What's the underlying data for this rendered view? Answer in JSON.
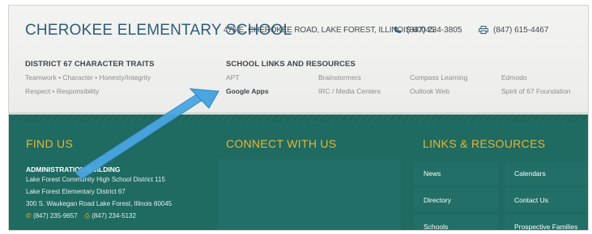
{
  "header": {
    "school_name": "CHEROKEE ELEMENTARY SCHOOL",
    "address": "475 E. CHEROKEE ROAD, LAKE FOREST, ILLINOIS 60045",
    "phone": "(847) 234-3805",
    "fax": "(847) 615-4467",
    "phone_icon": "phone-icon",
    "fax_icon": "printer-icon"
  },
  "traits": {
    "heading": "DISTRICT 67 CHARACTER TRAITS",
    "line1": "Teamwork • Character • Honesty/Integrity",
    "line2": "Respect • Responsibility"
  },
  "resources": {
    "heading": "SCHOOL LINKS AND RESOURCES",
    "links": [
      {
        "label": "APT"
      },
      {
        "label": "Brainstormers"
      },
      {
        "label": "Compass Learning"
      },
      {
        "label": "Edmodo"
      },
      {
        "label": "Google Apps"
      },
      {
        "label": "IRC / Media Centers"
      },
      {
        "label": "Outlook Web"
      },
      {
        "label": "Spirit of 67 Foundation"
      }
    ]
  },
  "footer": {
    "find_us": {
      "title": "FIND US",
      "admin_heading": "ADMINISTRATION BUILDING",
      "lines": [
        "Lake Forest Community High School District 115",
        "Lake Forest Elementary District 67",
        "300 S. Waukegan Road Lake Forest, Illinois 60045"
      ],
      "phone": "(847) 235-9657",
      "fax": "(847) 234-5132"
    },
    "connect": {
      "title": "CONNECT WITH US"
    },
    "links": {
      "title": "LINKS & RESOURCES",
      "items": [
        {
          "label": "News"
        },
        {
          "label": "Calendars"
        },
        {
          "label": "Directory"
        },
        {
          "label": "Contact Us"
        },
        {
          "label": "Schools"
        },
        {
          "label": "Prospective Families"
        }
      ]
    }
  },
  "colors": {
    "brand_blue": "#2b5e7b",
    "teal_bg": "#1f6a61",
    "gold": "#e8b632",
    "arrow": "#4aa6e0"
  }
}
